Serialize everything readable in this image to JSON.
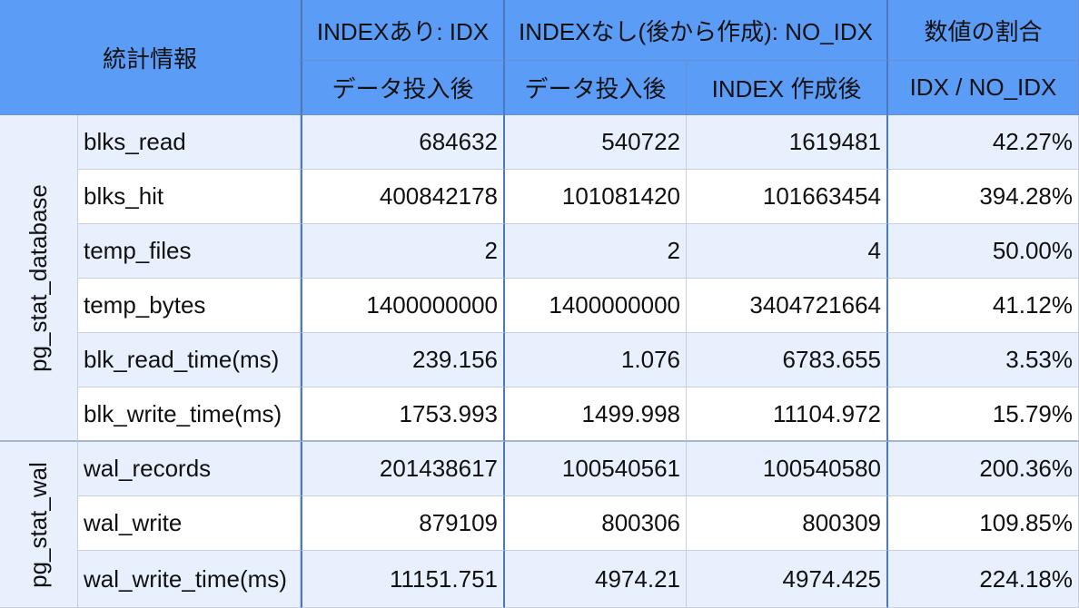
{
  "header": {
    "stats_label": "統計情報",
    "idx_group": "INDEXあり: IDX",
    "noidx_group": "INDEXなし(後から作成): NO_IDX",
    "ratio_group": "数値の割合",
    "idx_after_insert": "データ投入後",
    "noidx_after_insert": "データ投入後",
    "noidx_after_index": "INDEX 作成後",
    "ratio_formula": "IDX / NO_IDX"
  },
  "groups": [
    {
      "name": "pg_stat_database",
      "rows": [
        {
          "metric": "blks_read",
          "idx": "684632",
          "noidx_insert": "540722",
          "noidx_index": "1619481",
          "ratio": "42.27%"
        },
        {
          "metric": "blks_hit",
          "idx": "400842178",
          "noidx_insert": "101081420",
          "noidx_index": "101663454",
          "ratio": "394.28%"
        },
        {
          "metric": "temp_files",
          "idx": "2",
          "noidx_insert": "2",
          "noidx_index": "4",
          "ratio": "50.00%"
        },
        {
          "metric": "temp_bytes",
          "idx": "1400000000",
          "noidx_insert": "1400000000",
          "noidx_index": "3404721664",
          "ratio": "41.12%"
        },
        {
          "metric": "blk_read_time(ms)",
          "idx": "239.156",
          "noidx_insert": "1.076",
          "noidx_index": "6783.655",
          "ratio": "3.53%"
        },
        {
          "metric": "blk_write_time(ms)",
          "idx": "1753.993",
          "noidx_insert": "1499.998",
          "noidx_index": "11104.972",
          "ratio": "15.79%"
        }
      ]
    },
    {
      "name": "pg_stat_wal",
      "rows": [
        {
          "metric": "wal_records",
          "idx": "201438617",
          "noidx_insert": "100540561",
          "noidx_index": "100540580",
          "ratio": "200.36%"
        },
        {
          "metric": "wal_write",
          "idx": "879109",
          "noidx_insert": "800306",
          "noidx_index": "800309",
          "ratio": "109.85%"
        },
        {
          "metric": "wal_write_time(ms)",
          "idx": "11151.751",
          "noidx_insert": "4974.21",
          "noidx_index": "4974.425",
          "ratio": "224.18%"
        }
      ]
    }
  ]
}
